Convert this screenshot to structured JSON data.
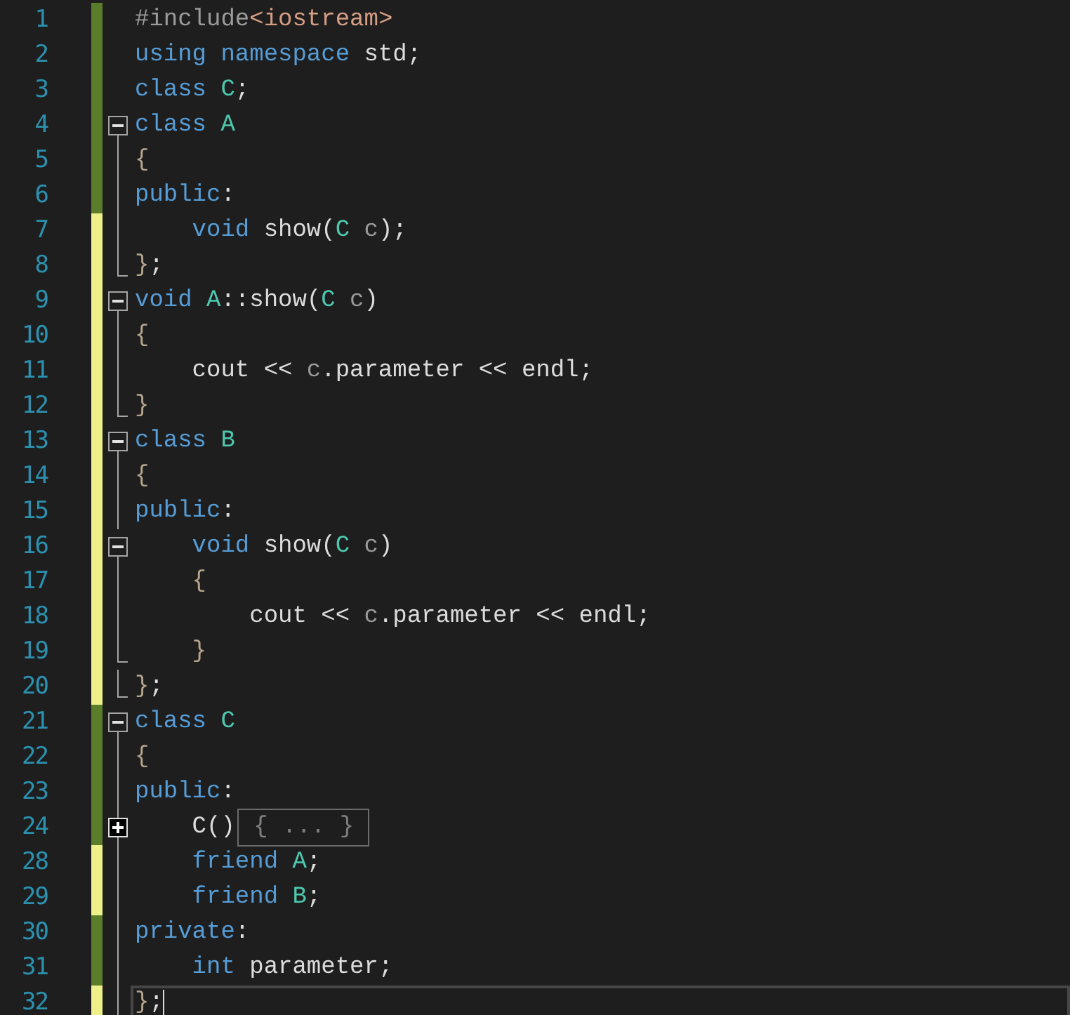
{
  "lines": [
    {
      "number": "1",
      "saved": true,
      "kind": "plain",
      "tokens": [
        {
          "kind": "preproc",
          "text": "#include"
        },
        {
          "kind": "string",
          "text": "<iostream>"
        }
      ]
    },
    {
      "number": "2",
      "saved": true,
      "kind": "plain",
      "tokens": [
        {
          "kind": "keyword",
          "text": "using namespace"
        },
        {
          "kind": "plain",
          "text": " std;"
        }
      ]
    },
    {
      "number": "3",
      "saved": true,
      "kind": "plain",
      "tokens": [
        {
          "kind": "keyword",
          "text": "class "
        },
        {
          "kind": "type",
          "text": "C"
        },
        {
          "kind": "plain",
          "text": ";"
        }
      ]
    },
    {
      "number": "4",
      "saved": true,
      "kind": "open",
      "tokens": [
        {
          "kind": "keyword",
          "text": "class "
        },
        {
          "kind": "type",
          "text": "A"
        }
      ]
    },
    {
      "number": "5",
      "saved": true,
      "kind": "inner",
      "tokens": [
        {
          "kind": "punct",
          "text": "{"
        }
      ]
    },
    {
      "number": "6",
      "saved": true,
      "kind": "inner",
      "tokens": [
        {
          "kind": "keyword",
          "text": "public"
        },
        {
          "kind": "plain",
          "text": ":"
        }
      ]
    },
    {
      "number": "7",
      "saved": false,
      "kind": "inner",
      "tokens": [
        {
          "kind": "keyword",
          "text": "    void "
        },
        {
          "kind": "plain",
          "text": "show("
        },
        {
          "kind": "type",
          "text": "C "
        },
        {
          "kind": "param",
          "text": "c"
        },
        {
          "kind": "plain",
          "text": ");"
        }
      ]
    },
    {
      "number": "8",
      "saved": false,
      "kind": "end",
      "tokens": [
        {
          "kind": "punct",
          "text": "}"
        },
        {
          "kind": "plain",
          "text": ";"
        }
      ]
    },
    {
      "number": "9",
      "saved": false,
      "kind": "open",
      "tokens": [
        {
          "kind": "keyword",
          "text": "void "
        },
        {
          "kind": "type",
          "text": "A"
        },
        {
          "kind": "plain",
          "text": "::show("
        },
        {
          "kind": "type",
          "text": "C "
        },
        {
          "kind": "param",
          "text": "c"
        },
        {
          "kind": "plain",
          "text": ")"
        }
      ]
    },
    {
      "number": "10",
      "saved": false,
      "kind": "inner",
      "tokens": [
        {
          "kind": "punct",
          "text": "{"
        }
      ]
    },
    {
      "number": "11",
      "saved": false,
      "kind": "inner",
      "tokens": [
        {
          "kind": "plain",
          "text": "    cout << "
        },
        {
          "kind": "param",
          "text": "c"
        },
        {
          "kind": "plain",
          "text": ".parameter << endl;"
        }
      ]
    },
    {
      "number": "12",
      "saved": false,
      "kind": "end",
      "tokens": [
        {
          "kind": "punct",
          "text": "}"
        }
      ]
    },
    {
      "number": "13",
      "saved": false,
      "kind": "open",
      "tokens": [
        {
          "kind": "keyword",
          "text": "class "
        },
        {
          "kind": "type",
          "text": "B"
        }
      ]
    },
    {
      "number": "14",
      "saved": false,
      "kind": "inner",
      "tokens": [
        {
          "kind": "punct",
          "text": "{"
        }
      ]
    },
    {
      "number": "15",
      "saved": false,
      "kind": "inner",
      "tokens": [
        {
          "kind": "keyword",
          "text": "public"
        },
        {
          "kind": "plain",
          "text": ":"
        }
      ]
    },
    {
      "number": "16",
      "saved": false,
      "kind": "open",
      "tokens": [
        {
          "kind": "keyword",
          "text": "    void "
        },
        {
          "kind": "plain",
          "text": "show("
        },
        {
          "kind": "type",
          "text": "C "
        },
        {
          "kind": "param",
          "text": "c"
        },
        {
          "kind": "plain",
          "text": ")"
        }
      ]
    },
    {
      "number": "17",
      "saved": false,
      "kind": "inner",
      "tokens": [
        {
          "kind": "punct",
          "text": "    {"
        }
      ]
    },
    {
      "number": "18",
      "saved": false,
      "kind": "inner",
      "tokens": [
        {
          "kind": "plain",
          "text": "        cout << "
        },
        {
          "kind": "param",
          "text": "c"
        },
        {
          "kind": "plain",
          "text": ".parameter << endl;"
        }
      ]
    },
    {
      "number": "19",
      "saved": false,
      "kind": "end",
      "tokens": [
        {
          "kind": "punct",
          "text": "    }"
        }
      ]
    },
    {
      "number": "20",
      "saved": false,
      "kind": "end",
      "tokens": [
        {
          "kind": "punct",
          "text": "}"
        },
        {
          "kind": "plain",
          "text": ";"
        }
      ]
    },
    {
      "number": "21",
      "saved": true,
      "kind": "open",
      "tokens": [
        {
          "kind": "keyword",
          "text": "class "
        },
        {
          "kind": "type",
          "text": "C"
        }
      ]
    },
    {
      "number": "22",
      "saved": true,
      "kind": "inner",
      "tokens": [
        {
          "kind": "punct",
          "text": "{"
        }
      ]
    },
    {
      "number": "23",
      "saved": true,
      "kind": "inner",
      "tokens": [
        {
          "kind": "keyword",
          "text": "public"
        },
        {
          "kind": "plain",
          "text": ":"
        }
      ]
    },
    {
      "number": "24",
      "saved": true,
      "kind": "collapsed",
      "tokens": [
        {
          "kind": "plain",
          "text": "    C()"
        },
        {
          "kind": "collapsed",
          "text": " { ... } "
        }
      ]
    },
    {
      "number": "28",
      "saved": false,
      "kind": "inner",
      "tokens": [
        {
          "kind": "keyword",
          "text": "    friend "
        },
        {
          "kind": "type",
          "text": "A"
        },
        {
          "kind": "plain",
          "text": ";"
        }
      ]
    },
    {
      "number": "29",
      "saved": false,
      "kind": "inner",
      "tokens": [
        {
          "kind": "keyword",
          "text": "    friend "
        },
        {
          "kind": "type",
          "text": "B"
        },
        {
          "kind": "plain",
          "text": ";"
        }
      ]
    },
    {
      "number": "30",
      "saved": true,
      "kind": "inner",
      "tokens": [
        {
          "kind": "keyword",
          "text": "private"
        },
        {
          "kind": "plain",
          "text": ":"
        }
      ]
    },
    {
      "number": "31",
      "saved": true,
      "kind": "inner",
      "tokens": [
        {
          "kind": "keyword",
          "text": "    int "
        },
        {
          "kind": "plain",
          "text": "parameter;"
        }
      ]
    },
    {
      "number": "32",
      "saved": false,
      "kind": "inner",
      "current": true,
      "tokens": [
        {
          "kind": "punct",
          "text": "}"
        },
        {
          "kind": "plain",
          "text": ";"
        }
      ]
    }
  ]
}
